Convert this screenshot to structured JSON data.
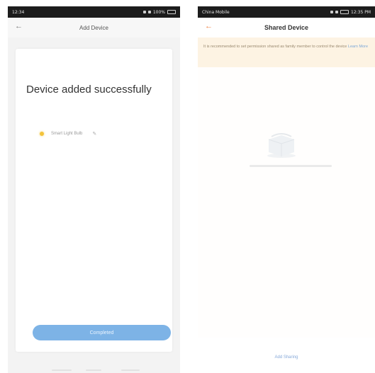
{
  "left_screen": {
    "status_time": "12:34",
    "status_right": "100%",
    "header_title": "Add Device",
    "back_glyph": "←",
    "success_title": "Device added successfully",
    "device_name": "Smart Light Bulb",
    "edit_glyph": "✎",
    "done_label": "Completed",
    "icons": {
      "back": "back-arrow-icon",
      "device": "bulb-icon",
      "edit": "edit-icon"
    }
  },
  "right_screen": {
    "status_left": "China Mobile",
    "status_right": "12:35 PM",
    "header_title": "Shared Device",
    "back_glyph": "←",
    "banner_text": "It is recommended to set permission shared as family member to control the device",
    "banner_link": "Learn More",
    "add_sharing_label": "Add Sharing",
    "icons": {
      "back": "back-arrow-icon",
      "empty": "empty-box-icon"
    }
  },
  "colors": {
    "accent_blue": "#7db3e6",
    "accent_orange": "#ef7d3c",
    "banner_bg": "#fdf3e3",
    "bulb_yellow": "#f3c33b"
  }
}
